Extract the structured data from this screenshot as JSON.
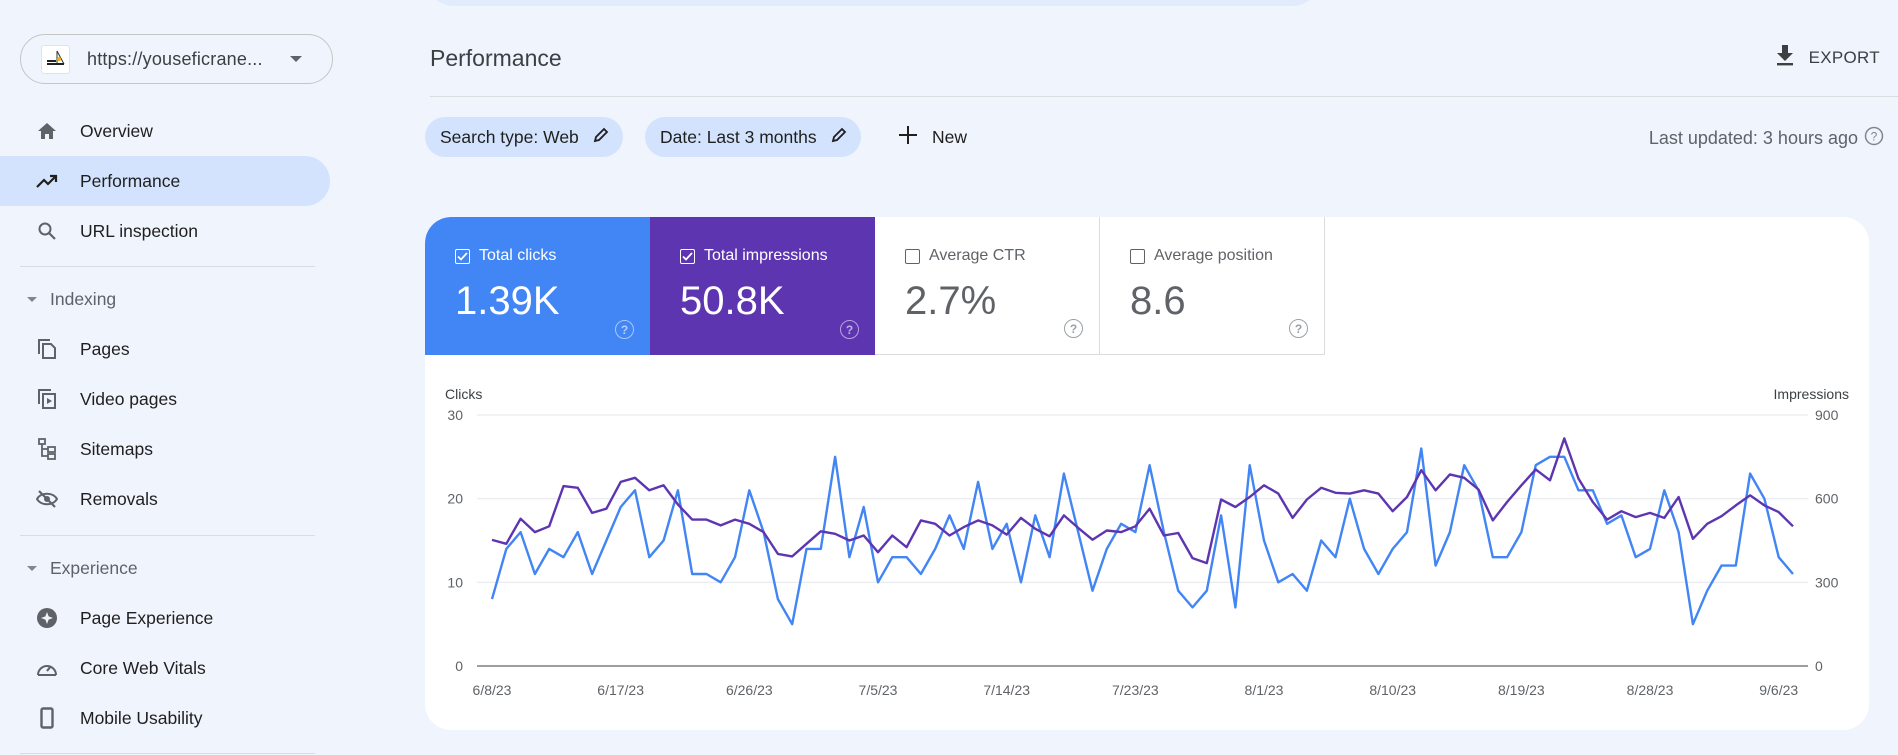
{
  "site": {
    "url": "https://youseficrane...",
    "favicon": "crane-logo-icon"
  },
  "sidebar": {
    "items": [
      {
        "label": "Overview",
        "icon": "home-icon"
      },
      {
        "label": "Performance",
        "icon": "trending-up-icon",
        "active": true
      },
      {
        "label": "URL inspection",
        "icon": "search-icon"
      }
    ],
    "sections": [
      {
        "title": "Indexing",
        "items": [
          {
            "label": "Pages",
            "icon": "pages-icon"
          },
          {
            "label": "Video pages",
            "icon": "video-pages-icon"
          },
          {
            "label": "Sitemaps",
            "icon": "sitemap-icon"
          },
          {
            "label": "Removals",
            "icon": "visibility-off-icon"
          }
        ]
      },
      {
        "title": "Experience",
        "items": [
          {
            "label": "Page Experience",
            "icon": "page-experience-icon"
          },
          {
            "label": "Core Web Vitals",
            "icon": "speed-gauge-icon"
          },
          {
            "label": "Mobile Usability",
            "icon": "smartphone-icon"
          }
        ]
      }
    ]
  },
  "header": {
    "title": "Performance",
    "export_label": "EXPORT"
  },
  "filters": {
    "chips": [
      {
        "label": "Search type: Web"
      },
      {
        "label": "Date: Last 3 months"
      }
    ],
    "new_label": "New",
    "last_updated": "Last updated: 3 hours ago"
  },
  "metrics": [
    {
      "label": "Total clicks",
      "value": "1.39K",
      "checked": true,
      "color": "#4285f4"
    },
    {
      "label": "Total impressions",
      "value": "50.8K",
      "checked": true,
      "color": "#5e35b1"
    },
    {
      "label": "Average CTR",
      "value": "2.7%",
      "checked": false
    },
    {
      "label": "Average position",
      "value": "8.6",
      "checked": false
    }
  ],
  "chart_data": {
    "type": "line",
    "title": "",
    "ylabel_left": "Clicks",
    "ylabel_right": "Impressions",
    "ylim_left": [
      0,
      30
    ],
    "ylim_right": [
      0,
      900
    ],
    "yticks_left": [
      "0",
      "10",
      "20",
      "30"
    ],
    "yticks_right": [
      "0",
      "300",
      "600",
      "900"
    ],
    "grid": true,
    "start_date": "6/8/23",
    "xtick_labels": [
      "6/8/23",
      "6/17/23",
      "6/26/23",
      "7/5/23",
      "7/14/23",
      "7/23/23",
      "8/1/23",
      "8/10/23",
      "8/19/23",
      "8/28/23",
      "9/6/23"
    ],
    "xtick_every_days": 9,
    "series": [
      {
        "name": "Clicks",
        "axis": "left",
        "color": "#4285f4",
        "values": [
          8,
          14,
          16,
          11,
          14,
          13,
          16,
          11,
          15,
          19,
          21,
          13,
          15,
          21,
          11,
          11,
          10,
          13,
          21,
          16,
          8,
          5,
          14,
          14,
          25,
          13,
          19,
          10,
          13,
          13,
          11,
          14,
          18,
          14,
          22,
          14,
          17,
          10,
          18,
          13,
          23,
          16,
          9,
          14,
          17,
          16,
          24,
          16,
          9,
          7,
          9,
          18,
          7,
          24,
          15,
          10,
          11,
          9,
          15,
          13,
          20,
          14,
          11,
          14,
          16,
          26,
          12,
          16,
          24,
          21,
          13,
          13,
          16,
          24,
          25,
          25,
          21,
          21,
          17,
          18,
          13,
          14,
          21,
          16,
          5,
          9,
          12,
          12,
          23,
          20,
          13,
          11
        ]
      },
      {
        "name": "Impressions",
        "axis": "right",
        "color": "#5e35b1",
        "values": [
          452,
          438,
          528,
          480,
          501,
          645,
          639,
          549,
          564,
          660,
          675,
          630,
          648,
          579,
          525,
          525,
          504,
          525,
          510,
          480,
          402,
          393,
          438,
          483,
          474,
          450,
          468,
          408,
          468,
          426,
          522,
          510,
          468,
          498,
          522,
          504,
          471,
          531,
          492,
          465,
          540,
          495,
          453,
          486,
          480,
          501,
          564,
          468,
          477,
          387,
          369,
          597,
          570,
          606,
          648,
          618,
          531,
          597,
          639,
          621,
          618,
          630,
          618,
          555,
          606,
          702,
          630,
          687,
          675,
          633,
          522,
          588,
          648,
          705,
          666,
          816,
          672,
          588,
          525,
          555,
          534,
          549,
          531,
          606,
          456,
          510,
          537,
          576,
          612,
          576,
          552,
          501
        ]
      }
    ]
  }
}
